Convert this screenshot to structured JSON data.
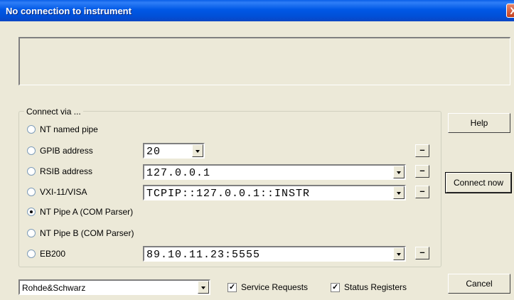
{
  "window": {
    "title": "No connection to instrument",
    "close_label": "X"
  },
  "message_area": {
    "text": ""
  },
  "connect_group": {
    "legend": "Connect via ...",
    "options": [
      {
        "label": "NT named pipe",
        "checked": false
      },
      {
        "label": "GPIB address",
        "checked": false,
        "value": "20"
      },
      {
        "label": "RSIB address",
        "checked": false,
        "value": "127.0.0.1"
      },
      {
        "label": "VXI-11/VISA",
        "checked": false,
        "value": "TCPIP::127.0.0.1::INSTR"
      },
      {
        "label": "NT Pipe A (COM Parser)",
        "checked": true
      },
      {
        "label": "NT Pipe B (COM Parser)",
        "checked": false
      },
      {
        "label": "EB200",
        "checked": false,
        "value": "89.10.11.23:5555"
      }
    ],
    "minus_label": "–"
  },
  "buttons": {
    "help": "Help",
    "connect_now": "Connect now",
    "cancel": "Cancel"
  },
  "footer": {
    "vendor": "Rohde&Schwarz",
    "service_requests": {
      "label": "Service Requests",
      "checked": true
    },
    "status_registers": {
      "label": "Status Registers",
      "checked": true
    }
  }
}
